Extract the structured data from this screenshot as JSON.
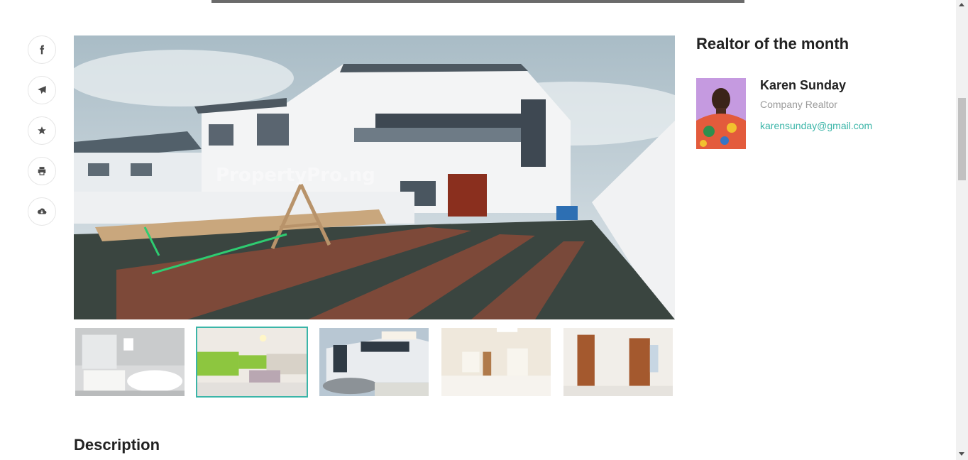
{
  "share_rail": {
    "items": [
      {
        "icon": "facebook-icon"
      },
      {
        "icon": "paper-plane-icon"
      },
      {
        "icon": "star-icon"
      },
      {
        "icon": "printer-icon"
      },
      {
        "icon": "cloud-download-icon"
      }
    ]
  },
  "gallery": {
    "watermark": "PropertyPro.ng",
    "thumbnails": [
      {
        "subject": "bathroom"
      },
      {
        "subject": "kitchen",
        "active": true
      },
      {
        "subject": "exterior"
      },
      {
        "subject": "empty room"
      },
      {
        "subject": "wardrobe room"
      }
    ]
  },
  "sidebar": {
    "title": "Realtor of the month",
    "realtor": {
      "name": "Karen Sunday",
      "role": "Company Realtor",
      "email": "karensunday@gmail.com"
    }
  },
  "description": {
    "heading": "Description"
  },
  "colors": {
    "accent": "#3bb5a8",
    "muted": "#9a9a9a"
  }
}
